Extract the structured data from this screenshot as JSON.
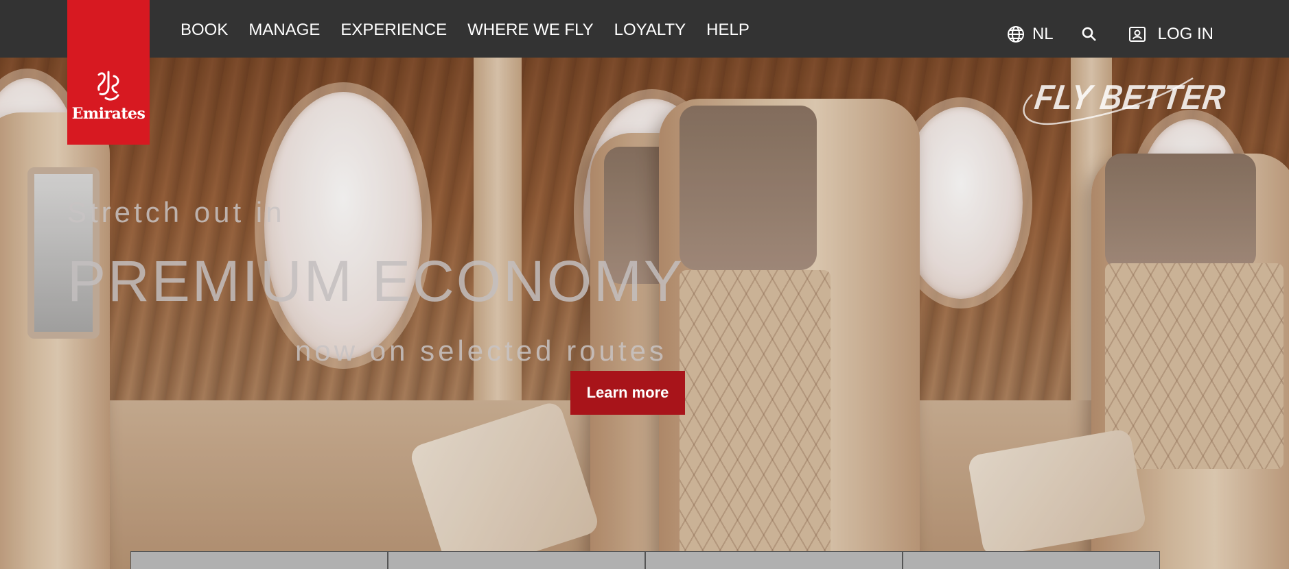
{
  "brand": {
    "name": "Emirates",
    "color": "#d71921"
  },
  "nav": {
    "items": [
      "BOOK",
      "MANAGE",
      "EXPERIENCE",
      "WHERE WE FLY",
      "LOYALTY",
      "HELP"
    ]
  },
  "header_right": {
    "language": "NL",
    "language_icon": "globe-icon",
    "search_icon": "search-icon",
    "login_label": "LOG IN",
    "login_icon": "login-icon"
  },
  "hero": {
    "tagline": "FLY BETTER",
    "line1": "Stretch out in",
    "line2": "PREMIUM ECONOMY",
    "line3": "now on selected routes",
    "cta_label": "Learn more",
    "cta_color": "#a8141a"
  },
  "tabs": {
    "count": 4
  }
}
